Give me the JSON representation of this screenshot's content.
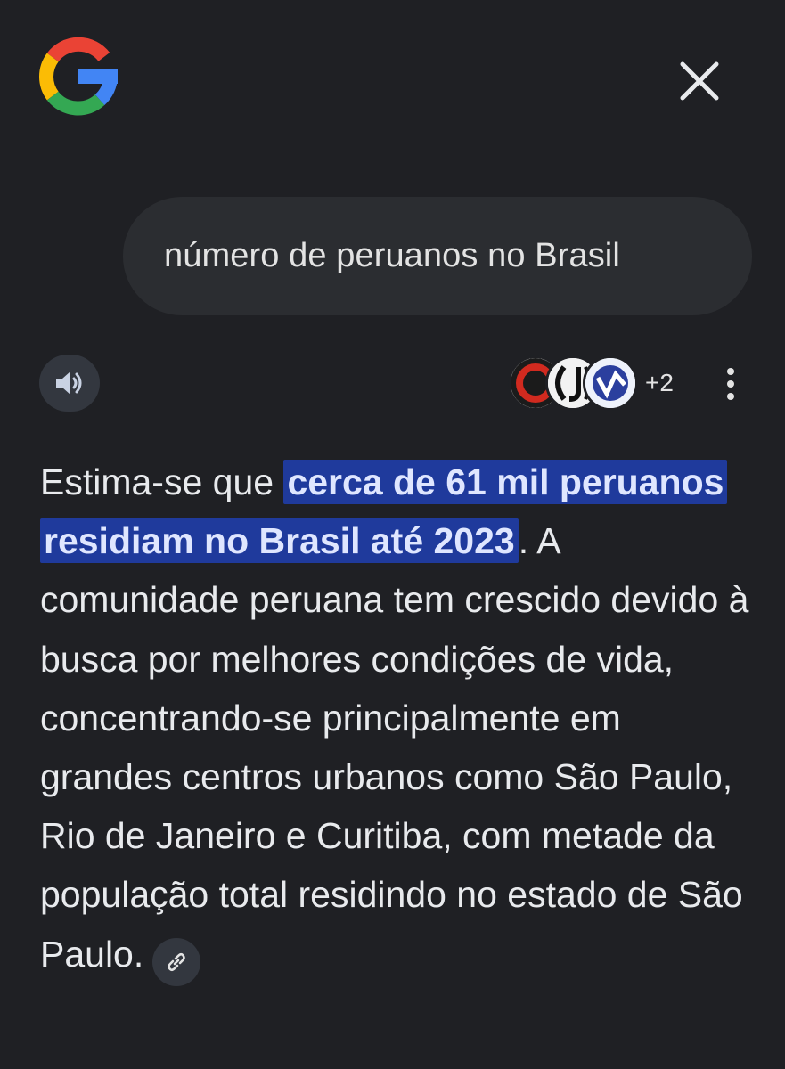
{
  "header": {
    "logo_icon": "google-g-logo",
    "close_icon": "close-icon"
  },
  "query": {
    "text": "número de peruanos no Brasil"
  },
  "toolbar": {
    "speaker_icon": "speaker-icon",
    "sources": {
      "icons": [
        "source-icon-red-circle",
        "source-icon-bw-logo",
        "source-icon-blue-logo"
      ],
      "more_label": "+2"
    },
    "more_icon": "more-vert-icon"
  },
  "answer": {
    "lead": "Estima-se que ",
    "highlight": "cerca de 61 mil peruanos residiam no Brasil até 2023",
    "body": ". A comunidade peruana tem crescido devido à busca por melhores condições de vida, concentrando-se principalmente em grandes centros urbanos como São Paulo, Rio de Janeiro e Curitiba, com metade da população total residindo no estado de São Paulo.",
    "link_icon": "link-icon"
  },
  "colors": {
    "background": "#1f2024",
    "bubble": "#2b2d31",
    "highlight": "#1f3a9c",
    "chip": "#33373f"
  }
}
